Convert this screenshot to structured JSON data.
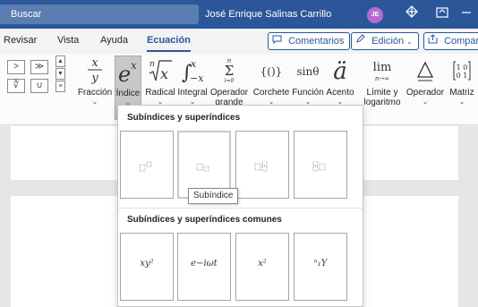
{
  "titlebar": {
    "search_label": "Buscar",
    "user_name": "José Enrique Salinas Carrillo",
    "avatar_initials": "JE",
    "icons": [
      "diamond-icon",
      "ribbon-display-icon",
      "minimize-icon",
      "restore-icon"
    ],
    "color": "#2b579a"
  },
  "tabs": {
    "items": [
      {
        "label": "Revisar"
      },
      {
        "label": "Vista"
      },
      {
        "label": "Ayuda"
      },
      {
        "label": "Ecuación",
        "active": true
      }
    ],
    "comments_label": "Comentarios",
    "editing_label": "Edición",
    "share_label": "Compartir"
  },
  "ribbon": {
    "symbols": [
      ">",
      "≫",
      "∜",
      "∪"
    ],
    "buttons": [
      {
        "label": "Fracción",
        "glyph": "x/y"
      },
      {
        "label": "Índice",
        "glyph": "eˣ",
        "pressed": true
      },
      {
        "label": "Radical",
        "glyph": "ⁿ√x"
      },
      {
        "label": "Integral",
        "glyph": "∫₋ₓˣ"
      },
      {
        "label": "Operador grande",
        "glyph": "Σ"
      },
      {
        "label": "Corchete",
        "glyph": "{()}"
      },
      {
        "label": "Función",
        "glyph": "sinθ"
      },
      {
        "label": "Acento",
        "glyph": "ä"
      },
      {
        "label": "Límite y logaritmo",
        "glyph": "lim"
      },
      {
        "label": "Operador",
        "glyph": "Δ"
      },
      {
        "label": "Matriz",
        "glyph": "[10;01]"
      }
    ]
  },
  "dropdown": {
    "section1_title": "Subíndices y superíndices",
    "section2_title": "Subíndices y superíndices comunes",
    "common_items": [
      "x_{y²}",
      "e^{−iωt}",
      "x²",
      "ⁿ₁Y"
    ],
    "common_display": [
      "xy²",
      "e−iωt",
      "x²",
      "ⁿ₁Y"
    ],
    "tooltip": "Subíndice"
  }
}
